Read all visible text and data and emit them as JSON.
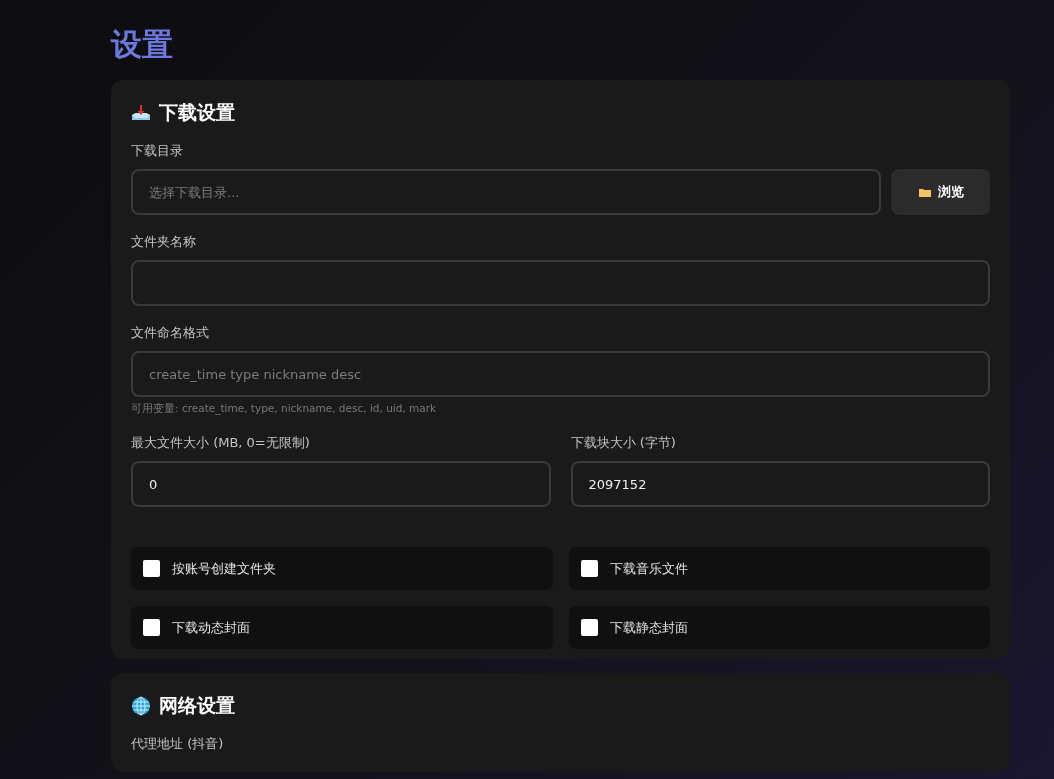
{
  "page_title": "设置",
  "sections": [
    {
      "kind": "download",
      "title": "下载设置",
      "directory": {
        "label": "下载目录",
        "placeholder": "选择下载目录...",
        "button": "浏览"
      },
      "folder_name": {
        "label": "文件夹名称"
      },
      "naming": {
        "label": "文件命名格式",
        "placeholder": "create_time type nickname desc",
        "hint": "可用变量: create_time, type, nickname, desc, id, uid, mark"
      },
      "sizes": [
        {
          "label": "最大文件大小 (MB, 0=无限制)",
          "value": "0"
        },
        {
          "label": "下载块大小 (字节)",
          "value": "2097152"
        }
      ],
      "options": [
        {
          "label": "按账号创建文件夹",
          "checked": false
        },
        {
          "label": "下载音乐文件",
          "checked": false
        },
        {
          "label": "下载动态封面",
          "checked": false
        },
        {
          "label": "下载静态封面",
          "checked": false
        }
      ]
    },
    {
      "kind": "network",
      "title": "网络设置",
      "field_label": "代理地址 (抖音)"
    }
  ]
}
